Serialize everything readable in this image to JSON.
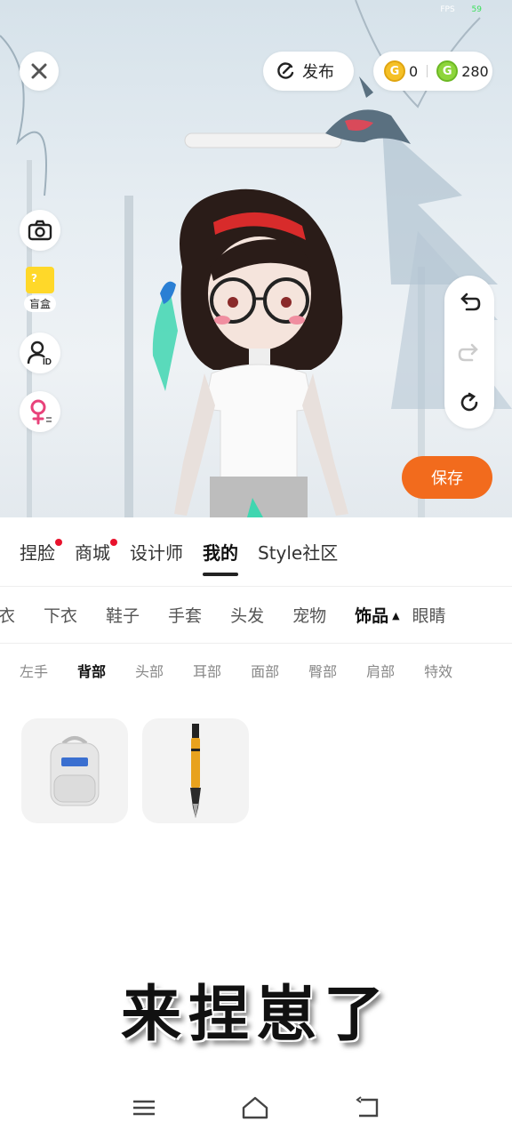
{
  "status_bar": {
    "fps_label": "FPS",
    "fps_value": "59"
  },
  "header": {
    "publish_label": "发布",
    "gold_coin_count": "0",
    "green_coin_count": "280",
    "gold_coin_symbol": "G",
    "green_coin_symbol": "G"
  },
  "side_tools": {
    "blindbox_label": "盲盒",
    "id_badge": "ID"
  },
  "save_label": "保存",
  "main_tabs": [
    {
      "label": "捏脸",
      "dot": true
    },
    {
      "label": "商城",
      "dot": true
    },
    {
      "label": "设计师",
      "dot": false
    },
    {
      "label": "我的",
      "dot": false,
      "active": true
    },
    {
      "label": "Style社区",
      "dot": false
    }
  ],
  "category_tabs": [
    "衣",
    "下衣",
    "鞋子",
    "手套",
    "头发",
    "宠物",
    "饰品",
    "眼睛"
  ],
  "category_active": "饰品",
  "sub_tabs": [
    "左手",
    "背部",
    "头部",
    "耳部",
    "面部",
    "臀部",
    "肩部",
    "特效"
  ],
  "sub_active": "背部",
  "items": [
    {
      "name": "backpack-icon"
    },
    {
      "name": "brush-pen-icon"
    }
  ],
  "caption": "来捏崽了",
  "colors": {
    "accent": "#f26b1d",
    "notification": "#e8122c",
    "gold": "#f5c026",
    "green": "#8ed53b"
  }
}
